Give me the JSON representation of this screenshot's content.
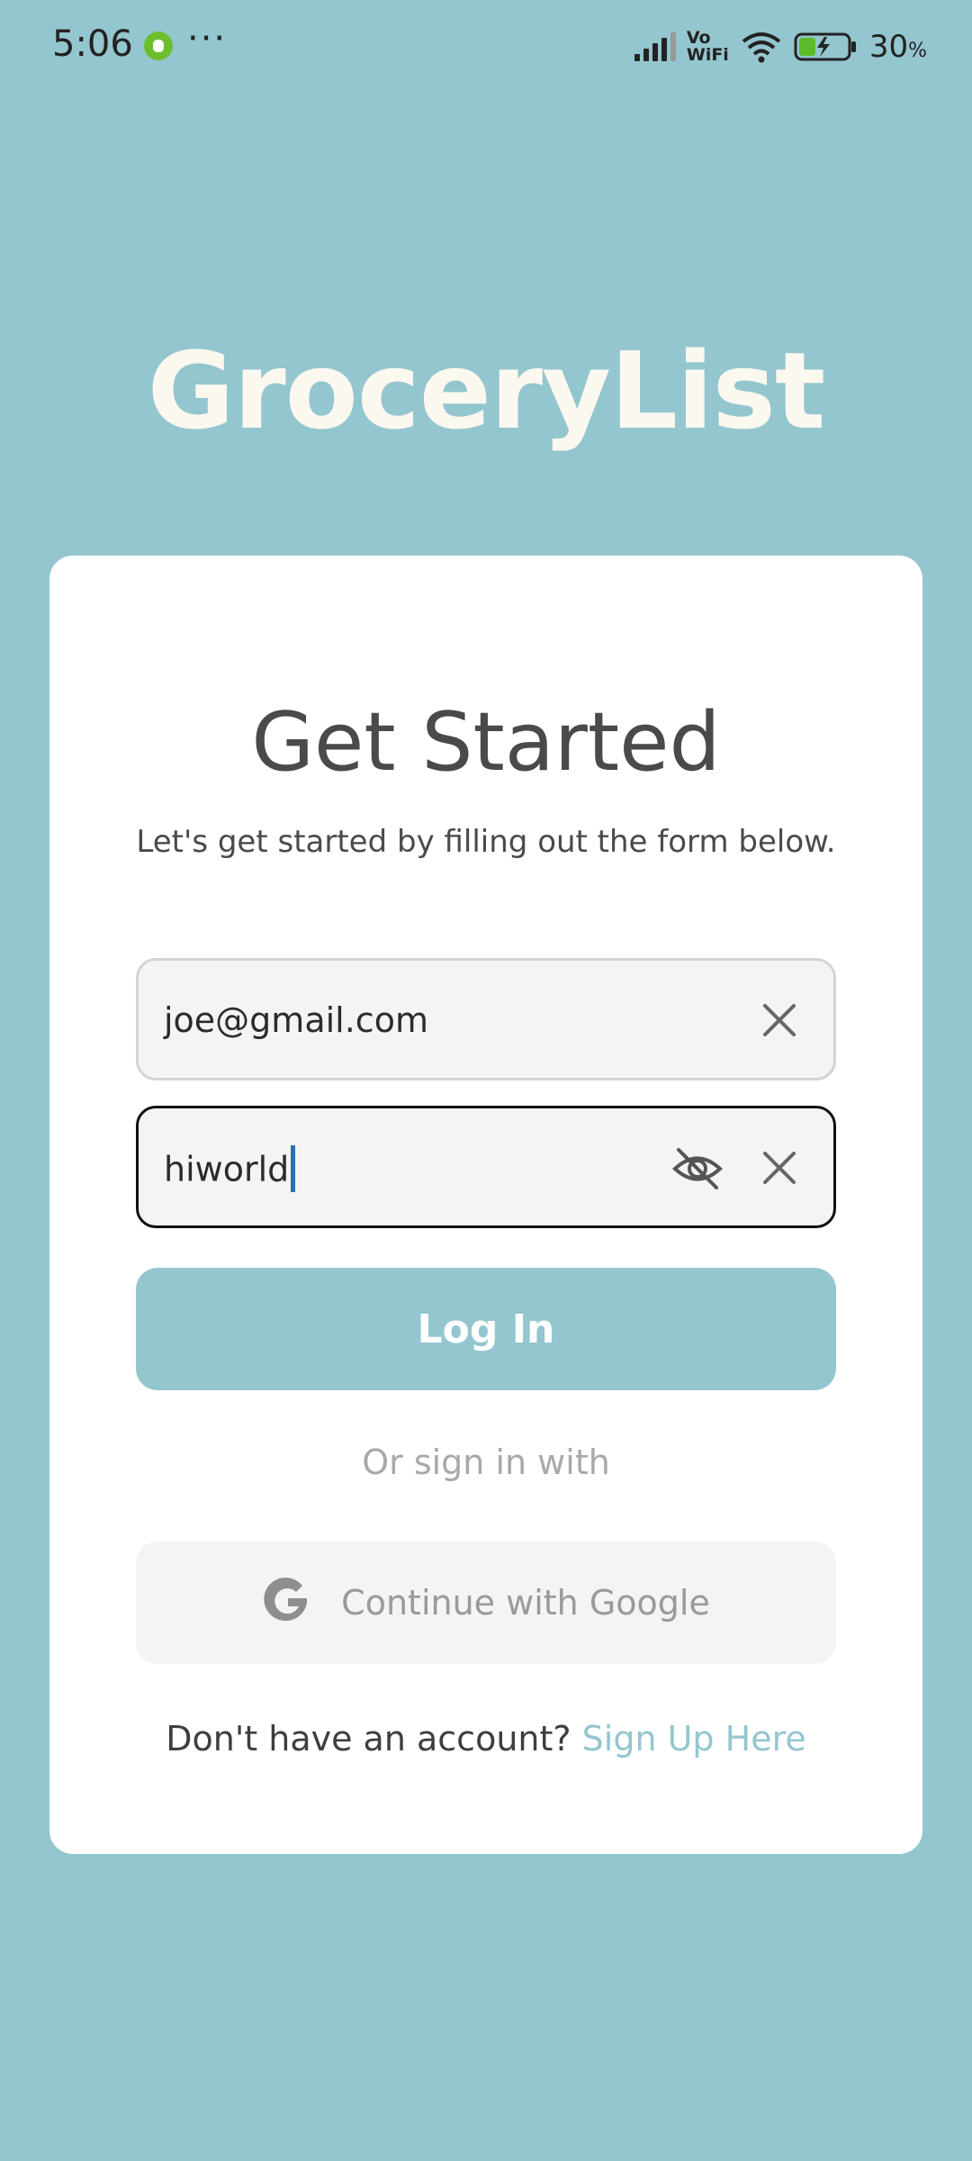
{
  "status_bar": {
    "time": "5:06",
    "more": "···",
    "vo": "Vo",
    "wifi_label": "WiFi",
    "battery_percent": "30",
    "percent_sign": "%"
  },
  "app": {
    "title": "GroceryList"
  },
  "form": {
    "heading": "Get Started",
    "subheading": "Let's get started by filling out the form below.",
    "email_value": "joe@gmail.com",
    "password_value": "hiworld",
    "login_label": "Log In",
    "or_text": "Or sign in with",
    "google_label": "Continue with Google",
    "signup_prompt": "Don't have an account?",
    "signup_link": "Sign Up Here"
  },
  "colors": {
    "background": "#94C6CF",
    "card": "#FFFFFF",
    "accent": "#94C6CF",
    "title": "#FBF8F0"
  },
  "icons": [
    "clear-icon",
    "visibility-off-icon",
    "google-icon",
    "signal-icon",
    "wifi-icon",
    "battery-icon"
  ]
}
